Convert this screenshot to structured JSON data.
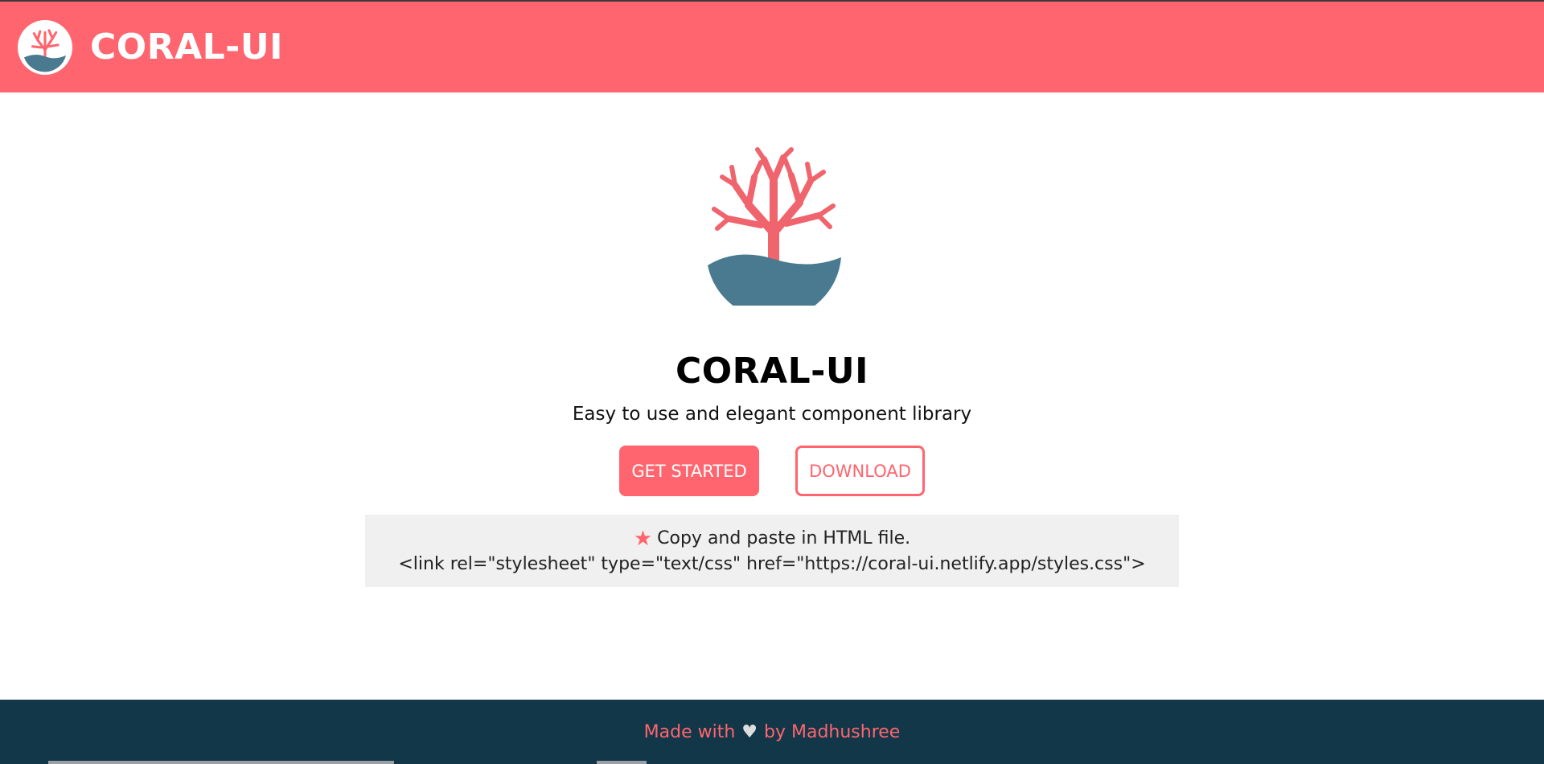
{
  "header": {
    "title": "CORAL-UI",
    "logo_icon": "coral-logo-icon"
  },
  "hero": {
    "logo_icon": "coral-logo-icon",
    "title": "CORAL-UI",
    "subtitle": "Easy to use and elegant component library",
    "primary_button": "GET STARTED",
    "secondary_button": "DOWNLOAD"
  },
  "install": {
    "icon": "star-icon",
    "instruction": "Copy and paste in HTML file.",
    "code": "<link rel=\"stylesheet\" type=\"text/css\" href=\"https://coral-ui.netlify.app/styles.css\">"
  },
  "footer": {
    "made_with": "Made with",
    "heart_icon": "heart-icon",
    "by": "by Madhushree"
  },
  "colors": {
    "brand": "#ff656e",
    "footer_bg": "#123748",
    "wave": "#4a7a90",
    "code_bg": "#f0f0f0"
  }
}
